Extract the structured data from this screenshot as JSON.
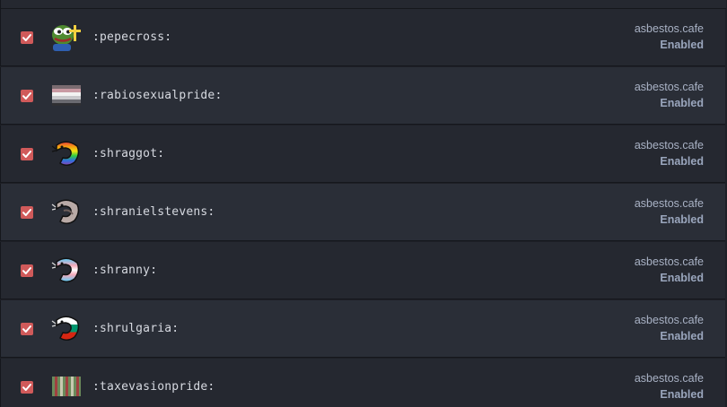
{
  "rows": [
    {
      "shortcode": ":pepecross:",
      "domain": "asbestos.cafe",
      "status": "Enabled",
      "checked": true,
      "icon": "pepe-cross-icon"
    },
    {
      "shortcode": ":rabiosexualpride:",
      "domain": "asbestos.cafe",
      "status": "Enabled",
      "checked": true,
      "icon": "rabiosexual-pride-flag-icon"
    },
    {
      "shortcode": ":shraggot:",
      "domain": "asbestos.cafe",
      "status": "Enabled",
      "checked": true,
      "icon": "shrimp-rainbow-icon"
    },
    {
      "shortcode": ":shranielstevens:",
      "domain": "asbestos.cafe",
      "status": "Enabled",
      "checked": true,
      "icon": "shrimp-grey-icon"
    },
    {
      "shortcode": ":shranny:",
      "domain": "asbestos.cafe",
      "status": "Enabled",
      "checked": true,
      "icon": "shrimp-trans-icon"
    },
    {
      "shortcode": ":shrulgaria:",
      "domain": "asbestos.cafe",
      "status": "Enabled",
      "checked": true,
      "icon": "shrimp-bulgaria-icon"
    },
    {
      "shortcode": ":taxevasionpride:",
      "domain": "asbestos.cafe",
      "status": "Enabled",
      "checked": true,
      "icon": "tax-evasion-pride-flag-icon"
    }
  ],
  "colors": {
    "checkbox": "#d05a5a",
    "background": "#1e2027",
    "row_odd": "#252830",
    "row_even": "#2a2e37"
  }
}
